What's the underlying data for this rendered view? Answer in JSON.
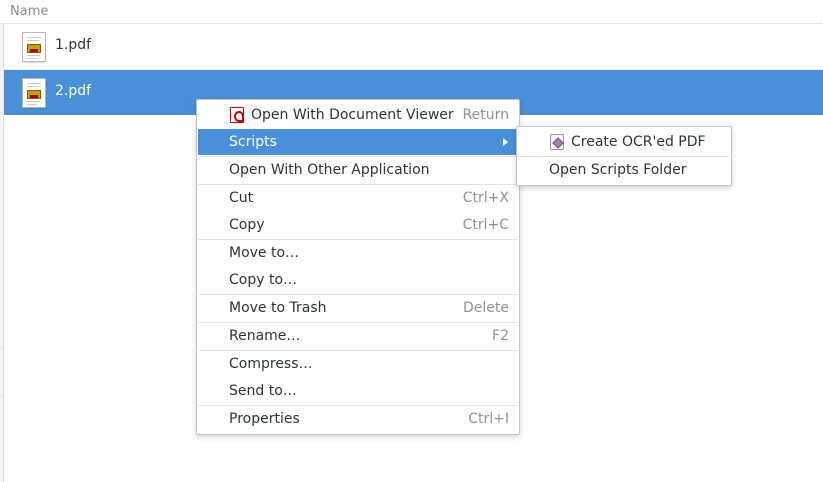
{
  "file_list": {
    "column_header": "Name",
    "files": [
      {
        "name": "1.pdf",
        "selected": false
      },
      {
        "name": "2.pdf",
        "selected": true
      }
    ],
    "selection_color": "#4a90d9"
  },
  "context_menu": {
    "items": [
      {
        "label": "Open With Document Viewer",
        "accel": "Return",
        "icon": "document-viewer-icon"
      },
      {
        "label": "Scripts",
        "accel": "",
        "submenu": true,
        "highlighted": true
      },
      {
        "label": "Open With Other Application",
        "accel": ""
      },
      {
        "label": "Cut",
        "accel": "Ctrl+X"
      },
      {
        "label": "Copy",
        "accel": "Ctrl+C"
      },
      {
        "label": "Move to…",
        "accel": ""
      },
      {
        "label": "Copy to…",
        "accel": ""
      },
      {
        "label": "Move to Trash",
        "accel": "Delete"
      },
      {
        "label": "Rename…",
        "accel": "F2"
      },
      {
        "label": "Compress…",
        "accel": ""
      },
      {
        "label": "Send to…",
        "accel": ""
      },
      {
        "label": "Properties",
        "accel": "Ctrl+I"
      }
    ]
  },
  "scripts_submenu": {
    "items": [
      {
        "label": "Create OCR'ed PDF",
        "icon": "script-icon"
      },
      {
        "label": "Open Scripts Folder"
      }
    ]
  }
}
